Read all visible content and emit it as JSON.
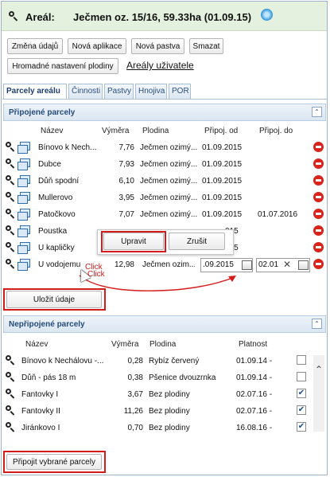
{
  "header": {
    "label": "Areál:",
    "value": "Ječmen oz. 15/16, 59.33ha (01.09.15)"
  },
  "toolbar": {
    "change": "Změna údajů",
    "new_app": "Nová aplikace",
    "new_pasture": "Nová pastva",
    "delete": "Smazat",
    "bulk": "Hromadné nastavení plodiny",
    "user_areas": "Areály uživatele"
  },
  "tabs": [
    "Parcely areálu",
    "Činnosti",
    "Pastvy",
    "Hnojiva",
    "POR"
  ],
  "connected": {
    "title": "Připojené parcely",
    "headers": {
      "name": "Název",
      "area": "Výměra",
      "crop": "Plodina",
      "from": "Připoj. od",
      "to": "Připoj. do"
    },
    "rows": [
      {
        "name": "Bínovo k Nech...",
        "area": "7,76",
        "crop": "Ječmen ozimý...",
        "from": "01.09.2015",
        "to": ""
      },
      {
        "name": "Dubce",
        "area": "7,93",
        "crop": "Ječmen ozimý...",
        "from": "01.09.2015",
        "to": ""
      },
      {
        "name": "Důň spodní",
        "area": "6,10",
        "crop": "Ječmen ozimý...",
        "from": "01.09.2015",
        "to": ""
      },
      {
        "name": "Mullerovo",
        "area": "3,95",
        "crop": "Ječmen ozimý...",
        "from": "01.09.2015",
        "to": ""
      },
      {
        "name": "Patočkovo",
        "area": "7,07",
        "crop": "Ječmen ozimý...",
        "from": "01.09.2015",
        "to": "01.07.2016"
      },
      {
        "name": "Poustka",
        "area": "",
        "crop": "",
        "from": "015",
        "to": ""
      },
      {
        "name": "U kapličky",
        "area": "",
        "crop": "",
        "from": "015",
        "to": ""
      }
    ],
    "edit_row": {
      "name": "U vodojemu",
      "area": "12,98",
      "crop": "Ječmen ozim...",
      "from": ".09.2015",
      "to": "02.01"
    },
    "popup": {
      "update": "Upravit",
      "cancel": "Zrušit"
    },
    "click1": "Click",
    "click2": "Click",
    "save": "Uložit údaje"
  },
  "disconnected": {
    "title": "Nepřipojené parcely",
    "headers": {
      "name": "Název",
      "area": "Výměra",
      "crop": "Plodina",
      "validity": "Platnost"
    },
    "rows": [
      {
        "name": "Bínovo k Nechálovu -...",
        "area": "0,28",
        "crop": "Rybíz červený",
        "validity": "01.09.14 -",
        "checked": false
      },
      {
        "name": "Důň - pás 18 m",
        "area": "0,38",
        "crop": "Pšenice dvouzrnka",
        "validity": "01.09.14 -",
        "checked": false
      },
      {
        "name": "Fantovky I",
        "area": "3,67",
        "crop": "Bez plodiny",
        "validity": "02.07.16 -",
        "checked": true
      },
      {
        "name": "Fantovky II",
        "area": "11,26",
        "crop": "Bez plodiny",
        "validity": "02.07.16 -",
        "checked": true
      },
      {
        "name": "Jiránkovo I",
        "area": "0,70",
        "crop": "Bez plodiny",
        "validity": "16.08.16 -",
        "checked": true
      }
    ],
    "attach": "Připojit vybrané parcely"
  },
  "colors": {
    "header_bg": "#e4f1df",
    "accent": "#2a4e80",
    "highlight": "#d51a1a",
    "delete": "#d9241b"
  }
}
